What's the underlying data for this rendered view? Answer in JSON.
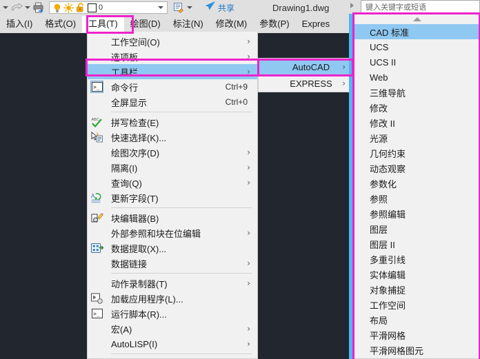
{
  "window": {
    "document_title": "Drawing1.dwg",
    "canvas_color": "#22272f",
    "accent_highlight": "#8fc9f2",
    "annotation_color": "#ee22cc"
  },
  "quick_access": {
    "icons": [
      {
        "name": "dropdown-caret-icon",
        "glyph": "▾"
      },
      {
        "name": "redo-arrow-icon",
        "glyph": "⇨"
      },
      {
        "name": "redo-dropdown-caret-icon",
        "glyph": "▾"
      },
      {
        "name": "plot-printer-icon",
        "glyph": "🖶"
      }
    ],
    "layer_control": {
      "bulb_icon": "layer-on-bulb-icon",
      "sun_icon": "layer-thaw-sun-icon",
      "lock_icon": "layer-unlocked-icon",
      "color_swatch": "#ffffff",
      "layer_value": "0",
      "dropdown_glyph": "▾"
    },
    "right_icons": [
      {
        "name": "layer-properties-icon",
        "glyph": "▤"
      },
      {
        "name": "toolbar-overflow-caret-icon",
        "glyph": "▾"
      }
    ],
    "share": {
      "icon": "share-paperplane-icon",
      "label": "共享"
    }
  },
  "search": {
    "placeholder": "键入关键字或短语",
    "caret_icon": "search-expand-caret-icon"
  },
  "menubar": {
    "items": [
      {
        "label": "插入(I)",
        "active": false
      },
      {
        "label": "格式(O)",
        "active": false
      },
      {
        "label": "工具(T)",
        "active": true
      },
      {
        "label": "绘图(D)",
        "active": false
      },
      {
        "label": "标注(N)",
        "active": false
      },
      {
        "label": "修改(M)",
        "active": false
      },
      {
        "label": "参数(P)",
        "active": false
      },
      {
        "label": "Expres",
        "active": false
      }
    ]
  },
  "tools_menu": {
    "items": [
      {
        "label": "工作空间(O)",
        "icon": "",
        "accel": "",
        "arrow": true,
        "highlight": false,
        "sep_after": false
      },
      {
        "label": "选项板",
        "icon": "",
        "accel": "",
        "arrow": true,
        "highlight": false,
        "sep_after": false
      },
      {
        "label": "工具栏",
        "icon": "",
        "accel": "",
        "arrow": true,
        "highlight": true,
        "sep_after": false
      },
      {
        "label": "命令行",
        "icon": "command-line-icon",
        "accel": "Ctrl+9",
        "arrow": false,
        "highlight": false,
        "sep_after": false
      },
      {
        "label": "全屏显示",
        "icon": "",
        "accel": "Ctrl+0",
        "arrow": false,
        "highlight": false,
        "sep_after": true
      },
      {
        "label": "拼写检查(E)",
        "icon": "spell-check-icon",
        "accel": "",
        "arrow": false,
        "highlight": false,
        "sep_after": false
      },
      {
        "label": "快速选择(K)...",
        "icon": "quick-select-icon",
        "accel": "",
        "arrow": false,
        "highlight": false,
        "sep_after": false
      },
      {
        "label": "绘图次序(D)",
        "icon": "",
        "accel": "",
        "arrow": true,
        "highlight": false,
        "sep_after": false
      },
      {
        "label": "隔离(I)",
        "icon": "",
        "accel": "",
        "arrow": true,
        "highlight": false,
        "sep_after": false
      },
      {
        "label": "查询(Q)",
        "icon": "",
        "accel": "",
        "arrow": true,
        "highlight": false,
        "sep_after": false
      },
      {
        "label": "更新字段(T)",
        "icon": "update-fields-icon",
        "accel": "",
        "arrow": false,
        "highlight": false,
        "sep_after": true
      },
      {
        "label": "块编辑器(B)",
        "icon": "block-editor-icon",
        "accel": "",
        "arrow": false,
        "highlight": false,
        "sep_after": false
      },
      {
        "label": "外部参照和块在位编辑",
        "icon": "",
        "accel": "",
        "arrow": true,
        "highlight": false,
        "sep_after": false
      },
      {
        "label": "数据提取(X)...",
        "icon": "data-extraction-icon",
        "accel": "",
        "arrow": false,
        "highlight": false,
        "sep_after": false
      },
      {
        "label": "数据链接",
        "icon": "",
        "accel": "",
        "arrow": true,
        "highlight": false,
        "sep_after": true
      },
      {
        "label": "动作录制器(T)",
        "icon": "",
        "accel": "",
        "arrow": true,
        "highlight": false,
        "sep_after": false
      },
      {
        "label": "加载应用程序(L)...",
        "icon": "load-application-icon",
        "accel": "",
        "arrow": false,
        "highlight": false,
        "sep_after": false
      },
      {
        "label": "运行脚本(R)...",
        "icon": "run-script-icon",
        "accel": "",
        "arrow": false,
        "highlight": false,
        "sep_after": false
      },
      {
        "label": "宏(A)",
        "icon": "",
        "accel": "",
        "arrow": true,
        "highlight": false,
        "sep_after": false
      },
      {
        "label": "AutoLISP(I)",
        "icon": "",
        "accel": "",
        "arrow": true,
        "highlight": false,
        "sep_after": true
      }
    ]
  },
  "toolbar_submenu": {
    "items": [
      {
        "label": "AutoCAD",
        "arrow": true,
        "highlight": true
      },
      {
        "label": "EXPRESS",
        "arrow": true,
        "highlight": false
      }
    ]
  },
  "toolbar_list": {
    "scroll_up_icon": "scroll-up-arrow-icon",
    "items": [
      {
        "label": "CAD 标准",
        "highlight": true
      },
      {
        "label": "UCS",
        "highlight": false
      },
      {
        "label": "UCS II",
        "highlight": false
      },
      {
        "label": "Web",
        "highlight": false
      },
      {
        "label": "三维导航",
        "highlight": false
      },
      {
        "label": "修改",
        "highlight": false
      },
      {
        "label": "修改 II",
        "highlight": false
      },
      {
        "label": "光源",
        "highlight": false
      },
      {
        "label": "几何约束",
        "highlight": false
      },
      {
        "label": "动态观察",
        "highlight": false
      },
      {
        "label": "参数化",
        "highlight": false
      },
      {
        "label": "参照",
        "highlight": false
      },
      {
        "label": "参照编辑",
        "highlight": false
      },
      {
        "label": "图层",
        "highlight": false
      },
      {
        "label": "图层 II",
        "highlight": false
      },
      {
        "label": "多重引线",
        "highlight": false
      },
      {
        "label": "实体编辑",
        "highlight": false
      },
      {
        "label": "对象捕捉",
        "highlight": false
      },
      {
        "label": "工作空间",
        "highlight": false
      },
      {
        "label": "布局",
        "highlight": false
      },
      {
        "label": "平滑网格",
        "highlight": false
      },
      {
        "label": "平滑网格图元",
        "highlight": false
      }
    ]
  }
}
